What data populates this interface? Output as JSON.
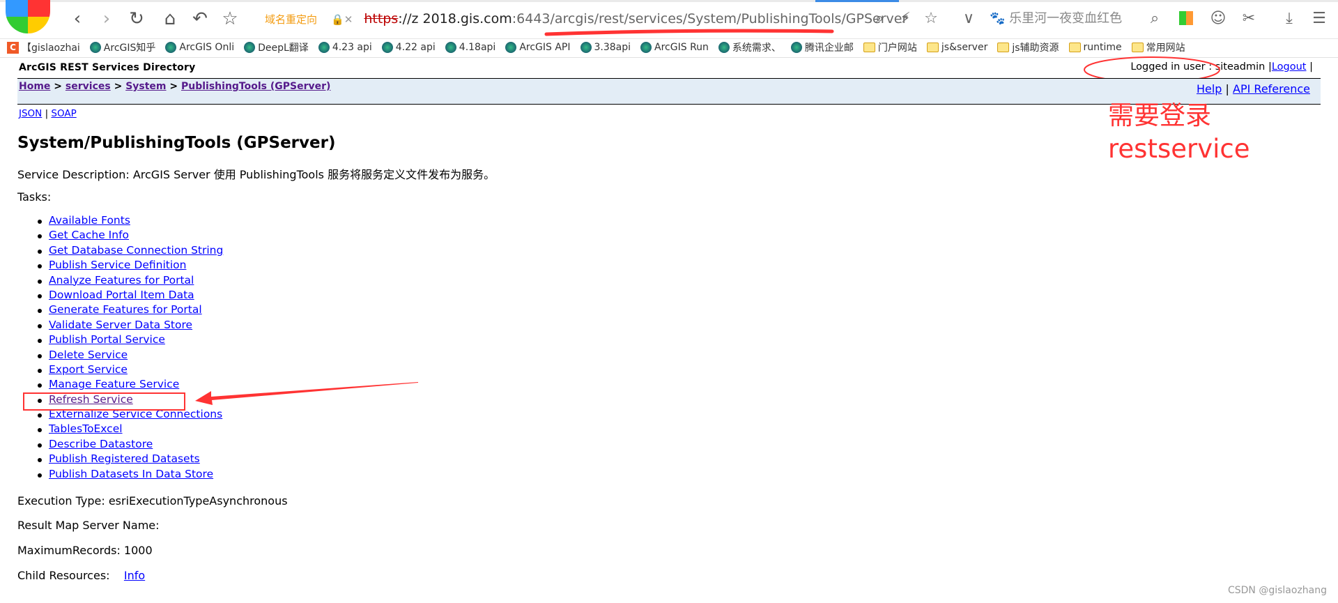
{
  "browser": {
    "url_prefix_label": "域名重定向",
    "url_scheme": "https",
    "url_host": "://z  2018.gis.com",
    "url_path": ":6443/arcgis/rest/services/System/PublishingTools/GPServer",
    "search_placeholder": "乐里河一夜变血红色",
    "bookmarks": [
      {
        "label": "【gislaozhai",
        "icon": "csdn"
      },
      {
        "label": "ArcGIS知乎",
        "icon": "globe"
      },
      {
        "label": "ArcGIS Onli",
        "icon": "globe"
      },
      {
        "label": "DeepL翻译",
        "icon": "deepl"
      },
      {
        "label": "4.23 api",
        "icon": "globe"
      },
      {
        "label": "4.22 api",
        "icon": "globe"
      },
      {
        "label": "4.18api",
        "icon": "image"
      },
      {
        "label": "ArcGIS API",
        "icon": "globe"
      },
      {
        "label": "3.38api",
        "icon": "globe"
      },
      {
        "label": "ArcGIS Run",
        "icon": "globe"
      },
      {
        "label": "系统需求、",
        "icon": "globe"
      },
      {
        "label": "腾讯企业邮",
        "icon": "tencent"
      },
      {
        "label": "门户网站",
        "icon": "folder"
      },
      {
        "label": "js&server",
        "icon": "folder"
      },
      {
        "label": "js辅助资源",
        "icon": "folder"
      },
      {
        "label": "runtime",
        "icon": "folder"
      },
      {
        "label": "常用网站",
        "icon": "folder"
      }
    ]
  },
  "header": {
    "directory_title": "ArcGIS REST Services Directory",
    "logged_in_label": "Logged in user : siteadmin",
    "logout": "Logout",
    "help": "Help",
    "api_reference": "API Reference"
  },
  "breadcrumb": [
    "Home",
    "services",
    "System",
    "PublishingTools (GPServer)"
  ],
  "formats": {
    "json": "JSON",
    "soap": "SOAP"
  },
  "service": {
    "title": "System/PublishingTools (GPServer)",
    "description_label": "Service Description:",
    "description": " ArcGIS Server 使用 PublishingTools 服务将服务定义文件发布为服务。",
    "tasks_label": "Tasks:",
    "tasks": [
      "Available Fonts",
      "Get Cache Info",
      "Get Database Connection String",
      "Publish Service Definition",
      "Analyze Features for Portal",
      "Download Portal Item Data",
      "Generate Features for Portal",
      "Validate Server Data Store",
      "Publish Portal Service",
      "Delete Service",
      "Export Service",
      "Manage Feature Service",
      "Refresh Service",
      "Externalize Service Connections",
      "TablesToExcel",
      "Describe Datastore",
      "Publish Registered Datasets",
      "Publish Datasets In Data Store"
    ],
    "execution_type_label": "Execution Type:",
    "execution_type": " esriExecutionTypeAsynchronous",
    "result_map_label": "Result Map Server Name:",
    "max_records_label": "MaximumRecords:",
    "max_records": " 1000",
    "child_resources_label": "Child Resources:",
    "child_info": "Info"
  },
  "annotation": {
    "line1": "需要登录",
    "line2": "restservice",
    "color": "#ff3333"
  },
  "watermark": "CSDN @gislaozhang"
}
